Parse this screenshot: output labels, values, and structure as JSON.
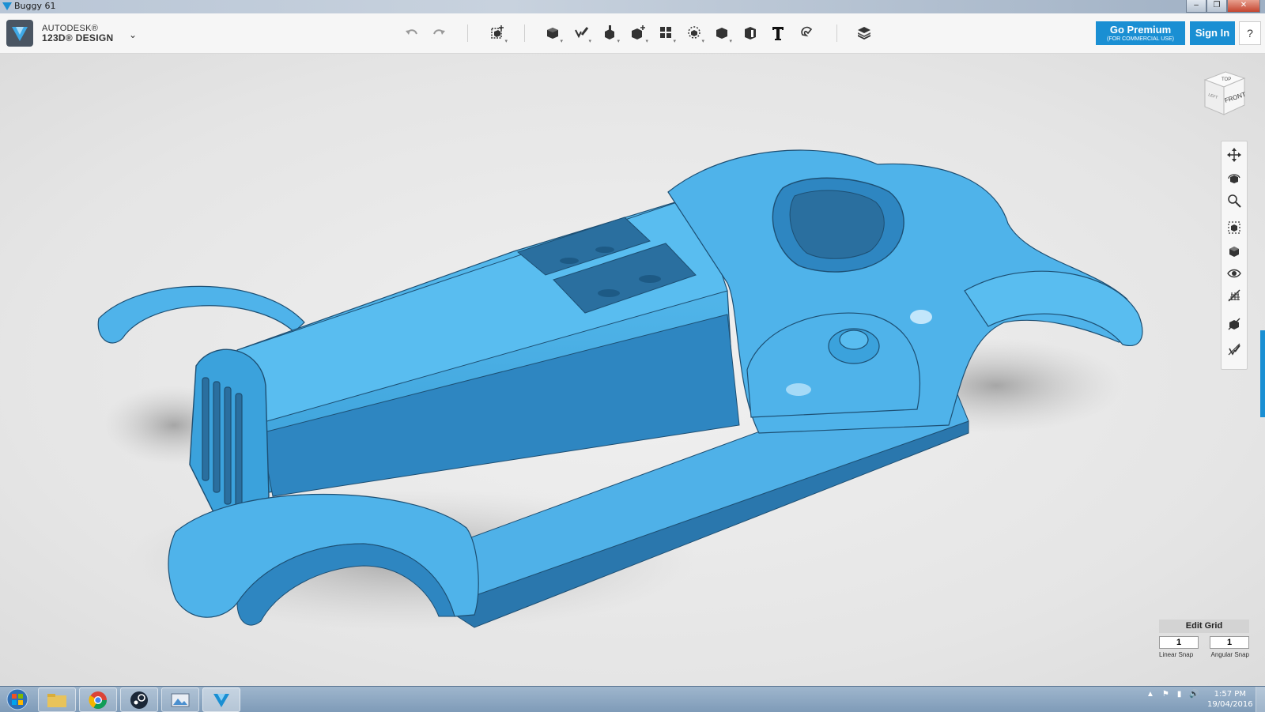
{
  "window": {
    "title": "Buggy 61",
    "controls": [
      "–",
      "❐",
      "✕"
    ]
  },
  "brand": {
    "line1": "AUTODESK®",
    "line2": "123D® DESIGN"
  },
  "toolbar": {
    "undo": "undo-icon",
    "redo": "redo-icon",
    "tools": [
      "transform",
      "primitives",
      "sketch",
      "construct",
      "modify",
      "pattern",
      "grouping",
      "combine",
      "measure",
      "text",
      "snap",
      "material"
    ]
  },
  "header_buttons": {
    "premium_label": "Go Premium",
    "premium_sub": "(FOR COMMERCIAL USE)",
    "signin_label": "Sign In",
    "help_label": "?"
  },
  "viewcube": {
    "top": "TOP",
    "front": "FRONT",
    "left": "LEFT"
  },
  "nav_tools": [
    "pan",
    "orbit",
    "zoom",
    "fit",
    "view-mode",
    "visibility",
    "grid-toggle",
    "material-toggle",
    "outline-toggle"
  ],
  "edit_grid": {
    "title": "Edit Grid",
    "linear_value": "1",
    "angular_value": "1",
    "linear_label": "Linear Snap",
    "angular_label": "Angular Snap"
  },
  "taskbar": {
    "items": [
      "explorer",
      "chrome",
      "steam",
      "photos",
      "123d-design"
    ],
    "time": "1:57 PM",
    "date": "19/04/2016"
  },
  "colors": {
    "accent": "#1a8fd3",
    "model": "#4fb3ea",
    "model_dark": "#2b7fb8"
  }
}
